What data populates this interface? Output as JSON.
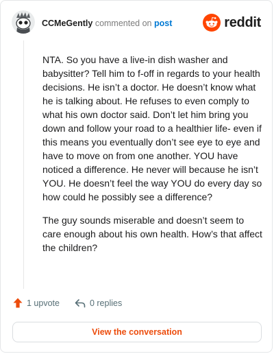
{
  "header": {
    "username": "CCMeGently",
    "commented_text": "commented on",
    "post_link": "post"
  },
  "logo": {
    "wordmark": "reddit",
    "brand_color": "#ff4500"
  },
  "comment": {
    "paragraphs": [
      "NTA. So you have a live-in dish washer and babysitter? Tell him to f-off in regards to your health decisions. He isn’t a doctor. He doesn’t know what he is talking about. He refuses to even comply to what his own doctor said. Don’t let him bring you down and follow your road to a healthier life- even if this means you eventually don’t see eye to eye and have to move on from one another. YOU have noticed a difference. He never will because he isn’t YOU. He doesn’t feel the way YOU do every day so how could he possibly see a difference?",
      "The guy sounds miserable and doesn’t seem to care enough about his own health. How’s that affect the children?"
    ]
  },
  "actions": {
    "upvote_label": "1 upvote",
    "replies_label": "0 replies",
    "upvote_icon": "upvote-arrow-icon",
    "reply_icon": "reply-arrow-icon"
  },
  "footer": {
    "view_button_label": "View the conversation"
  },
  "colors": {
    "accent_orange": "#ec4c0c",
    "link_blue": "#0079d3"
  }
}
